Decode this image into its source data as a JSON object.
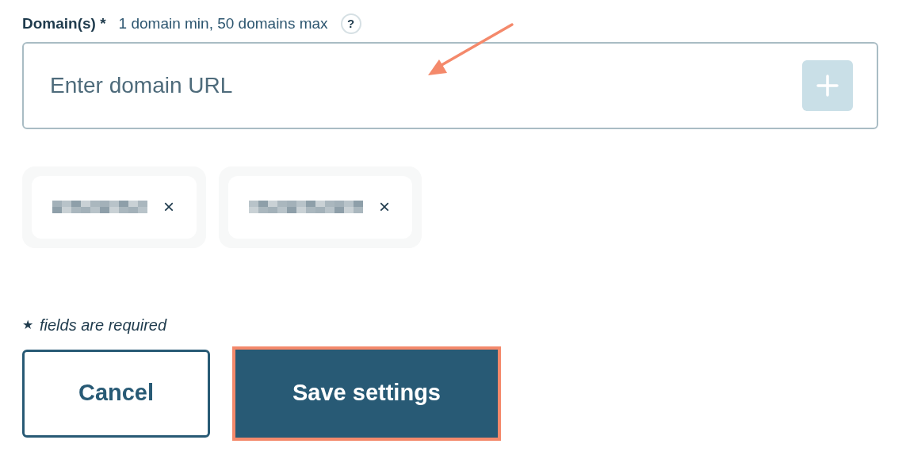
{
  "field": {
    "label": "Domain(s)",
    "required_mark": "*",
    "hint": "1 domain min, 50 domains max",
    "help": "?",
    "placeholder": "Enter domain URL",
    "add_button": {
      "disabled": true
    }
  },
  "chips": [
    {
      "remove": "×"
    },
    {
      "remove": "×"
    }
  ],
  "note": {
    "mark": "★",
    "text": "fields are required"
  },
  "buttons": [
    {
      "label": "Cancel",
      "kind": "outline",
      "highlighted": false
    },
    {
      "label": "Save settings",
      "kind": "primary",
      "highlighted": true
    }
  ]
}
